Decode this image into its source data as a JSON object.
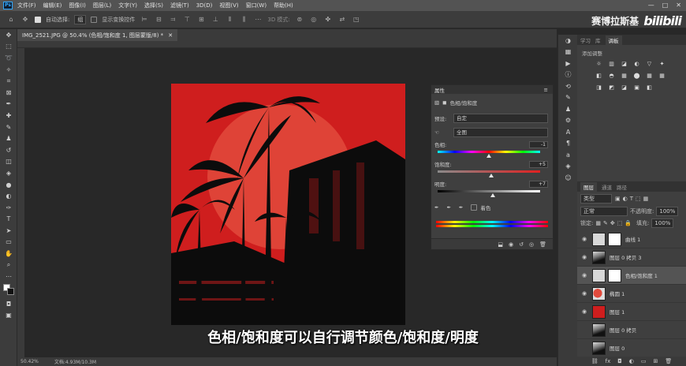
{
  "menubar": {
    "app_icon": "Ps",
    "items": [
      "文件(F)",
      "编辑(E)",
      "图像(I)",
      "图层(L)",
      "文字(Y)",
      "选择(S)",
      "滤镜(T)",
      "3D(D)",
      "视图(V)",
      "窗口(W)",
      "帮助(H)"
    ],
    "window_controls": [
      "—",
      "□",
      "✕"
    ]
  },
  "options": {
    "auto_select_label": "自动选择:",
    "auto_select_value": "组",
    "transform_label": "显示变换控件",
    "mode_3d": "3D 模式:"
  },
  "brand": {
    "name": "赛博拉斯基",
    "logo": "bilibili"
  },
  "document": {
    "tab_title": "IMG_2521.JPG @ 50.4% (色相/饱和度 1, 图层蒙版/8) *",
    "zoom": "50.42%",
    "doc_info": "文档:4.93M/10.3M"
  },
  "properties": {
    "panel_title": "属性",
    "adjustment_name": "色相/饱和度",
    "preset_label": "预设:",
    "preset_value": "自定",
    "channel_value": "全图",
    "hue_label": "色相:",
    "hue_value": "-1",
    "hue_level": -1,
    "saturation_label": "饱和度:",
    "saturation_value": "+5",
    "saturation_level": 5,
    "lightness_label": "明度:",
    "lightness_value": "+7",
    "lightness_level": 7,
    "colorize_label": "着色"
  },
  "right_panel": {
    "tabs_top": [
      "学习",
      "库",
      "调板"
    ],
    "adjust_title": "添加调整",
    "adjust_icons": [
      "☼",
      "▥",
      "◪",
      "◐",
      "▽",
      "✦",
      "◧",
      "◓",
      "▦",
      "⬤",
      "▦",
      "▦",
      "◨",
      "◩",
      "◪",
      "▣",
      "◧"
    ],
    "tabs_layers": [
      "图层",
      "通道",
      "路径"
    ],
    "kind_label": "类型",
    "blend_mode": "正常",
    "opacity_label": "不透明度:",
    "opacity_value": "100%",
    "lock_label": "锁定:",
    "fill_label": "填充:",
    "fill_value": "100%",
    "layers": [
      {
        "name": "曲线 1",
        "visible": true,
        "kind": "adjust"
      },
      {
        "name": "图层 0 拷贝 3",
        "visible": true,
        "kind": "image"
      },
      {
        "name": "色相/饱和度 1",
        "visible": true,
        "kind": "adjust"
      },
      {
        "name": "椭圆 1",
        "visible": true,
        "kind": "circle"
      },
      {
        "name": "图层 1",
        "visible": true,
        "kind": "red"
      },
      {
        "name": "图层 0 拷贝",
        "visible": false,
        "kind": "image"
      },
      {
        "name": "图层 0",
        "visible": false,
        "kind": "image"
      }
    ]
  },
  "subtitle": "色相/饱和度可以自行调节颜色/饱和度/明度",
  "colors": {
    "accent": "#31a8ff",
    "image_red": "#cf1e1e",
    "sun": "#e24a3c"
  }
}
